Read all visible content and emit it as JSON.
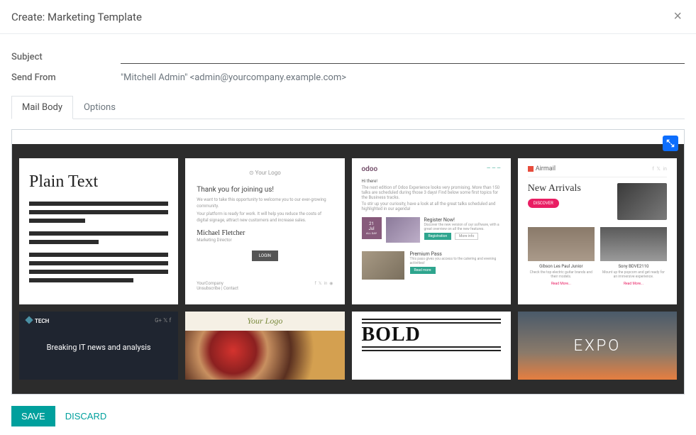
{
  "modal": {
    "title": "Create: Marketing Template",
    "close_icon": "×"
  },
  "form": {
    "subject_label": "Subject",
    "subject_value": "",
    "send_from_label": "Send From",
    "send_from_value": "\"Mitchell Admin\" <admin@yourcompany.example.com>"
  },
  "tabs": {
    "mail_body": "Mail Body",
    "options": "Options"
  },
  "expand_icon": "expand",
  "templates": {
    "plain_text": {
      "title": "Plain Text"
    },
    "thankyou": {
      "logo": "⊙ Your Logo",
      "heading": "Thank you for joining us!",
      "line1": "We want to take this opportunity to welcome you to our ever-growing community.",
      "line2": "Your platform is ready for work. It will help you reduce the costs of digital signage, attract new customers and increase sales.",
      "sig_name": "Michael Fletcher",
      "sig_role": "Marketing Director",
      "login": "LOGIN",
      "footer_company": "YourCompany",
      "footer_links": "Unsubscribe | Contact"
    },
    "odoo": {
      "brand": "odoo",
      "hi": "Hi there!",
      "intro1": "The next edition of Odoo Experience looks very promising. More than 150 talks are scheduled during those 3 days! Find below some first topics for the Business tracks.",
      "intro2": "To stir up your curiosity, have a look at all the great talks scheduled and highlighted in our agenda!",
      "date_day": "21",
      "date_month": "Jul",
      "date_sub": "ALL DAY",
      "event_title": "Register Now!",
      "event_desc": "Discover the new version of our software, with a great overview on all the new features.",
      "register": "Registration",
      "more": "More info",
      "premium_title": "Premium Pass",
      "premium_desc": "This pass gives you access to the catering and evening activities!",
      "read_more": "Read more"
    },
    "airmail": {
      "brand": "Airmail",
      "hero_title": "New Arrivals",
      "discover": "DISCOVER",
      "product1_name": "Gibson Les Paul Junior",
      "product1_desc": "Check the top electric guitar brands and their models.",
      "product1_link": "Read More...",
      "product2_name": "Sony BDVE2110",
      "product2_desc": "Mount up the popcorn and get ready for an immersive experience.",
      "product2_link": "Read More..."
    },
    "tech": {
      "brand": "TECH",
      "headline": "Breaking IT news and analysis"
    },
    "food": {
      "logo": "Your Logo"
    },
    "bold": {
      "title": "BOLD"
    },
    "expo": {
      "title": "EXPO"
    }
  },
  "footer": {
    "save": "SAVE",
    "discard": "DISCARD"
  }
}
